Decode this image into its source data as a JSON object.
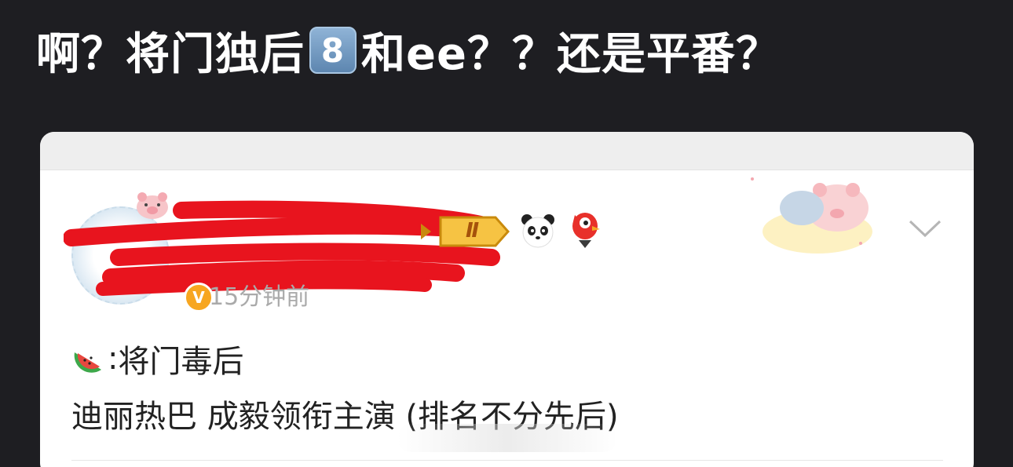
{
  "header": {
    "part1": "啊？将门独后",
    "keycap_number": "8",
    "part2": "和ee？？还是平番？"
  },
  "post": {
    "timestamp": "15分钟前",
    "vip_letter": "V",
    "level_badge": "Ⅱ",
    "line1_colon": ": ",
    "line1_title": "将门毒后",
    "line2": "迪丽热巴 成毅领衔主演 (排名不分先后)"
  },
  "icons": {
    "emoji_keycap": "keycap-8-icon",
    "watermelon": "watermelon-icon",
    "panda": "panda-icon",
    "bird": "bird-icon",
    "chevron": "chevron-down-icon"
  },
  "colors": {
    "background": "#1e1e22",
    "card": "#ffffff",
    "redaction": "#e8141e",
    "vip": "#f7a620"
  }
}
